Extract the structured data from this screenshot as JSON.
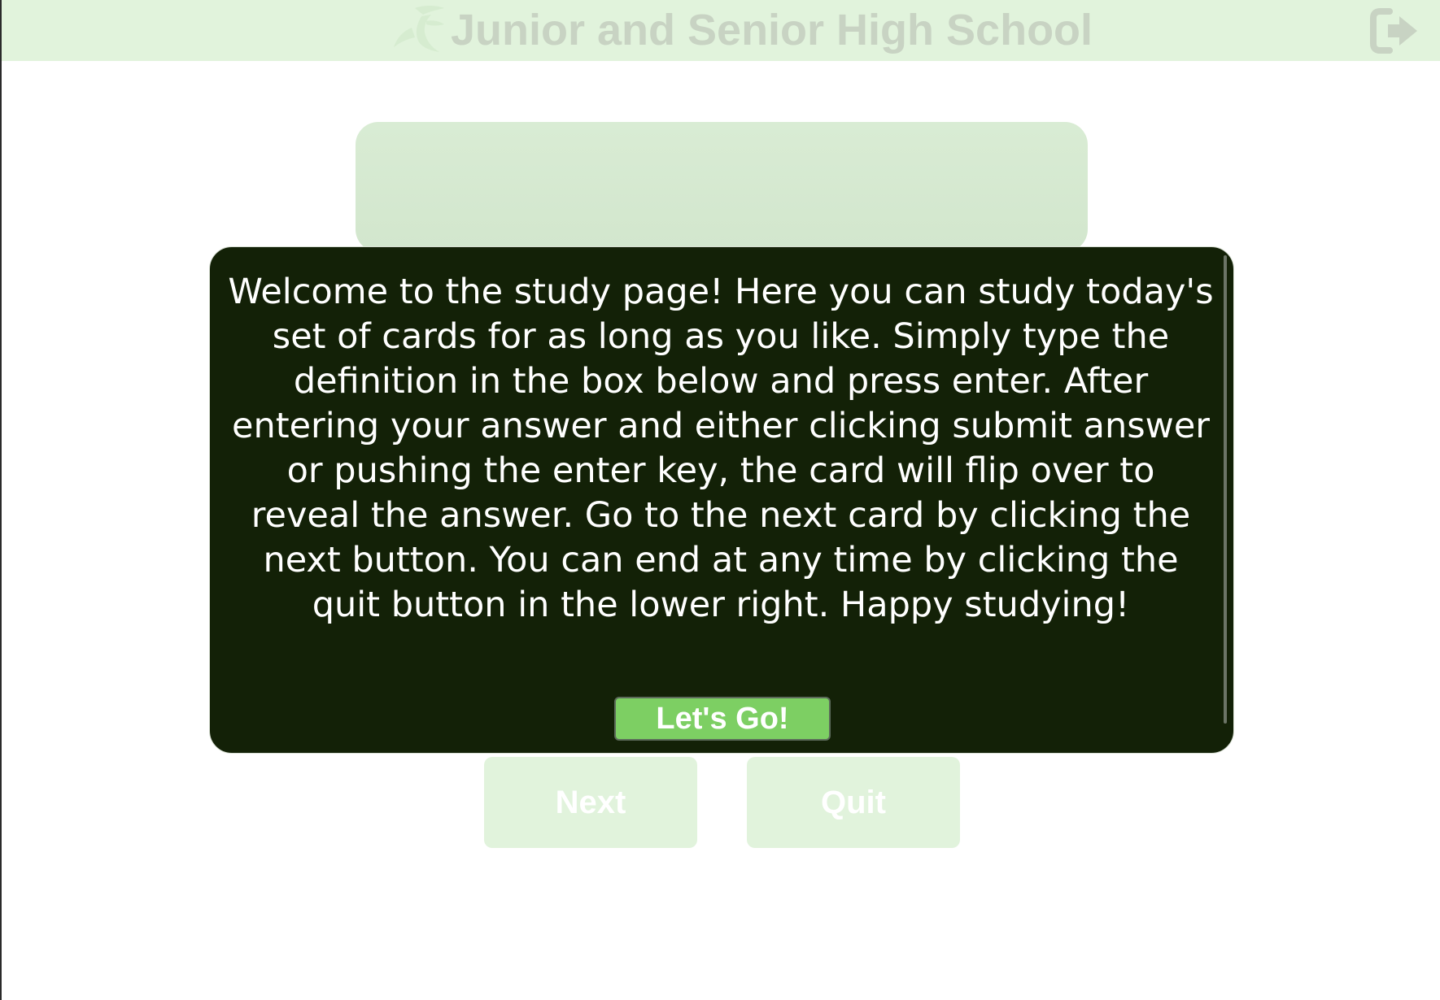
{
  "header": {
    "title": "Junior and Senior High School",
    "logo_icon": "leaf-logo-icon",
    "logout_icon": "sign-out-icon"
  },
  "modal": {
    "message": "Welcome to the study page! Here you can study today's set of cards for as long as you like. Simply type the definition in the box below and press enter. After entering your answer and either clicking submit answer or pushing the enter key, the card will flip over to reveal the answer. Go to the next card by clicking the next button. You can end at any time by clicking the quit button in the lower right. Happy studying!",
    "button_label": "Let's Go!"
  },
  "controls": {
    "next_label": "Next",
    "quit_label": "Quit"
  },
  "colors": {
    "header_bg": "#e1f3dc",
    "modal_bg": "#132107",
    "accent_green": "#7dcf63",
    "card_bg": "#d5e9d0"
  }
}
